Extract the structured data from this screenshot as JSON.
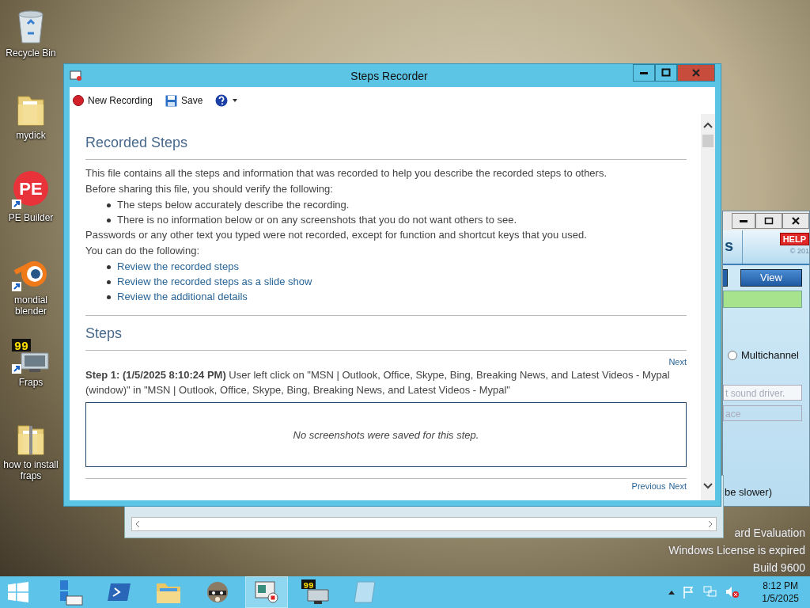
{
  "desktop": {
    "icons": [
      {
        "kind": "recycle",
        "label": "Recycle Bin",
        "shortcut": false
      },
      {
        "kind": "folder",
        "label": "mydick",
        "shortcut": false
      },
      {
        "kind": "pe",
        "label": "PE Builder",
        "badge": "PE",
        "shortcut": true
      },
      {
        "kind": "blender",
        "label": "mondial blender",
        "shortcut": true
      },
      {
        "kind": "fraps",
        "label": "Fraps",
        "badge": "99",
        "shortcut": true
      },
      {
        "kind": "zip",
        "label": "how to install fraps",
        "shortcut": false
      }
    ],
    "notice": [
      "ard Evaluation",
      "Windows License is expired",
      "Build 9600"
    ]
  },
  "background_window": {
    "help": "HELP",
    "copyright": "© 201",
    "tab_fragment": "s",
    "view_button": "View",
    "radio": {
      "label": "Multichannel",
      "selected": false
    },
    "field_1": "t sound driver.",
    "field_2": "ace",
    "note_fragment": "be slower)"
  },
  "steps_recorder": {
    "title": "Steps Recorder",
    "toolbar": [
      {
        "kind": "record",
        "label": "New Recording"
      },
      {
        "kind": "save",
        "label": "Save"
      },
      {
        "kind": "help"
      }
    ],
    "heading": "Recorded Steps",
    "intro": "This file contains all the steps and information that was recorded to help you describe the recorded steps to others.",
    "verify": "Before sharing this file, you should verify the following:",
    "bullets": [
      "The steps below accurately describe the recording.",
      "There is no information below or on any screenshots that you do not want others to see."
    ],
    "passwords": "Passwords or any other text you typed were not recorded, except for function and shortcut keys that you used.",
    "can_do": "You can do the following:",
    "links": [
      "Review the recorded steps",
      "Review the recorded steps as a slide show",
      "Review the additional details"
    ],
    "steps_heading": "Steps",
    "steps": [
      {
        "nav": [
          "Next"
        ],
        "title": "Step 1: (1/5/2025 8:10:24 PM)",
        "text": "User left click on \"MSN | Outlook, Office, Skype, Bing, Breaking News, and Latest Videos - Mypal (window)\" in \"MSN | Outlook, Office, Skype, Bing, Breaking News, and Latest Videos - Mypal\"",
        "screenshot_note": "No screenshots were saved for this step."
      }
    ],
    "bottom_nav": [
      "Previous",
      "Next"
    ]
  },
  "taskbar": {
    "apps": [
      {
        "kind": "server",
        "selected": false
      },
      {
        "kind": "powershell",
        "selected": false
      },
      {
        "kind": "explorer",
        "selected": false
      },
      {
        "kind": "raccoon",
        "selected": false
      },
      {
        "kind": "recorder",
        "selected": true
      },
      {
        "kind": "fraps",
        "badge": "99",
        "selected": false
      },
      {
        "kind": "notepad",
        "selected": false
      }
    ],
    "time": "8:12 PM",
    "date": "1/5/2025"
  }
}
